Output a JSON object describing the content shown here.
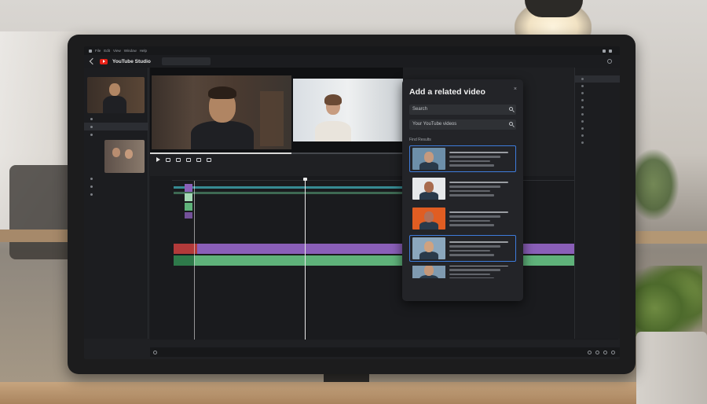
{
  "app": {
    "name": "YouTube Studio"
  },
  "menubar": {
    "items": [
      "File",
      "Edit",
      "View",
      "Window",
      "Help"
    ]
  },
  "modal": {
    "title": "Add a related video",
    "close_label": "×",
    "search_placeholder": "Search",
    "own_videos_label": "Your YouTube videos",
    "section_label": "Find Results",
    "results": [
      {
        "selected": true,
        "thumb_bg": "#6d8fa9",
        "person": "#c69a7e"
      },
      {
        "selected": false,
        "thumb_bg": "#e7e9eb",
        "person": "#a86b4d"
      },
      {
        "selected": false,
        "thumb_bg": "#e05d22",
        "person": "#b0705a"
      },
      {
        "selected": true,
        "thumb_bg": "#8ba7bd",
        "person": "#d0a27f"
      },
      {
        "selected": false,
        "thumb_bg": "#7f9ab0",
        "person": "#c59778"
      }
    ]
  },
  "colors": {
    "accent": "#3e7cdc",
    "brand_red": "#e62117",
    "track_green": "#5fb27a",
    "track_purple": "#8a5fb8",
    "track_red": "#b23a3a",
    "track_cyan": "#3fa7b0"
  },
  "icons": {
    "back": "back-arrow-icon",
    "logo": "youtube-logo-icon",
    "play": "play-icon",
    "search": "search-icon",
    "close": "close-icon"
  }
}
